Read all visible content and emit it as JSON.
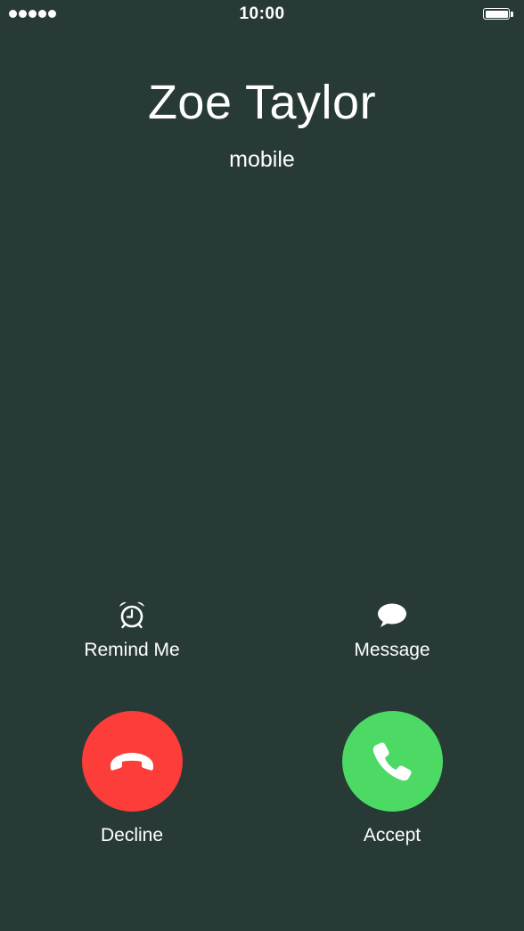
{
  "status_bar": {
    "time": "10:00",
    "signal_bars": 5,
    "battery_level": 1.0
  },
  "caller": {
    "name": "Zoe Taylor",
    "label": "mobile"
  },
  "options": {
    "remind": {
      "label": "Remind Me",
      "icon": "alarm-clock-icon"
    },
    "message": {
      "label": "Message",
      "icon": "speech-bubble-icon"
    }
  },
  "actions": {
    "decline": {
      "label": "Decline",
      "icon": "phone-hangup-icon",
      "color": "#fc3d39"
    },
    "accept": {
      "label": "Accept",
      "icon": "phone-icon",
      "color": "#4cd964"
    }
  },
  "colors": {
    "background": "#283a36",
    "foreground": "#ffffff"
  }
}
